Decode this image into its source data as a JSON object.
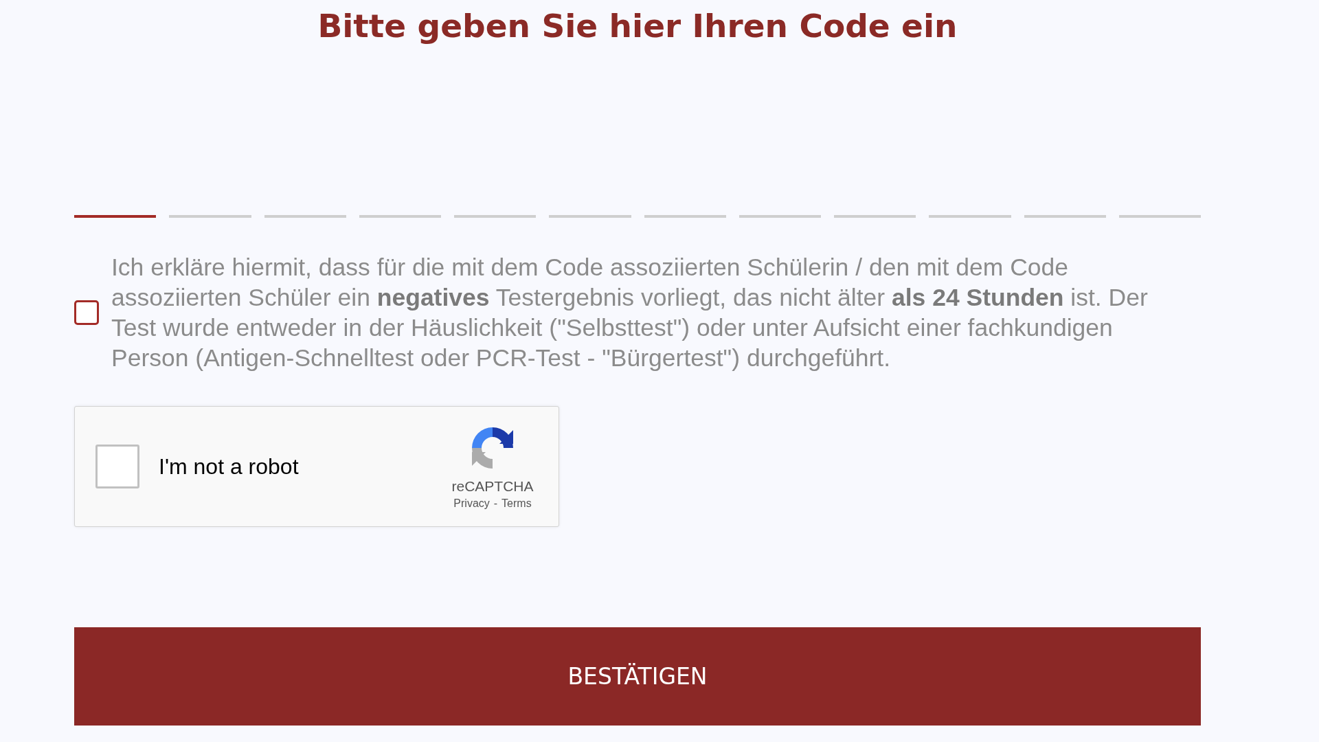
{
  "title": "Bitte geben Sie hier Ihren Code ein",
  "code_slots": [
    {
      "selected": true
    },
    {
      "selected": false
    },
    {
      "selected": false
    },
    {
      "selected": false
    },
    {
      "selected": false
    },
    {
      "selected": false
    },
    {
      "selected": false
    },
    {
      "selected": false
    },
    {
      "selected": false
    },
    {
      "selected": false
    },
    {
      "selected": false
    },
    {
      "selected": false
    }
  ],
  "consent": {
    "checked": false,
    "text": "Ich erkläre hiermit, dass für die mit dem Code assoziierten Schülerin / den mit dem Code assoziierten Schüler ein **negatives** Testergebnis vorliegt, das nicht älter **als 24 Stunden** ist. Der Test wurde entweder in der Häuslichkeit (\"Selbsttest\") oder unter Aufsicht einer fachkundigen Person (Antigen-Schnelltest oder PCR-Test - \"Bürgertest\") durchgeführt."
  },
  "captcha": {
    "checked": false,
    "label": "I'm not a robot",
    "brand": "reCAPTCHA",
    "links": [
      "Privacy",
      "-",
      "Terms"
    ]
  },
  "submit_button": "BESTÄTIGEN"
}
